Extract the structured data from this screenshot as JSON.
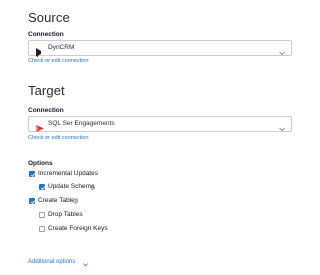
{
  "source": {
    "heading": "Source",
    "connection_label": "Connection",
    "selected_value": "DynCRM",
    "link": "Check or edit connection"
  },
  "target": {
    "heading": "Target",
    "connection_label": "Connection",
    "selected_value": "SQL Ser Engagements",
    "link": "Check or edit connection"
  },
  "options": {
    "heading": "Options",
    "incremental_updates": {
      "label": "Incremental Updates",
      "checked": true
    },
    "update_schema": {
      "label": "Update Schema",
      "checked": true
    },
    "create_tables": {
      "label": "Create Tables",
      "checked": true
    },
    "drop_tables": {
      "label": "Drop Tables",
      "checked": false
    },
    "create_foreign_keys": {
      "label": "Create Foreign Keys",
      "checked": false
    }
  },
  "additional_options": {
    "label": "Additional options"
  },
  "colors": {
    "accent": "#1f74c7",
    "border": "#c9cdd3",
    "text": "#1f2937"
  },
  "icons": {
    "source_app": "dynamics-logo-icon",
    "target_app": "sql-server-logo-icon",
    "dropdown": "chevron-down-icon",
    "info": "info-icon",
    "check": "check-icon"
  }
}
